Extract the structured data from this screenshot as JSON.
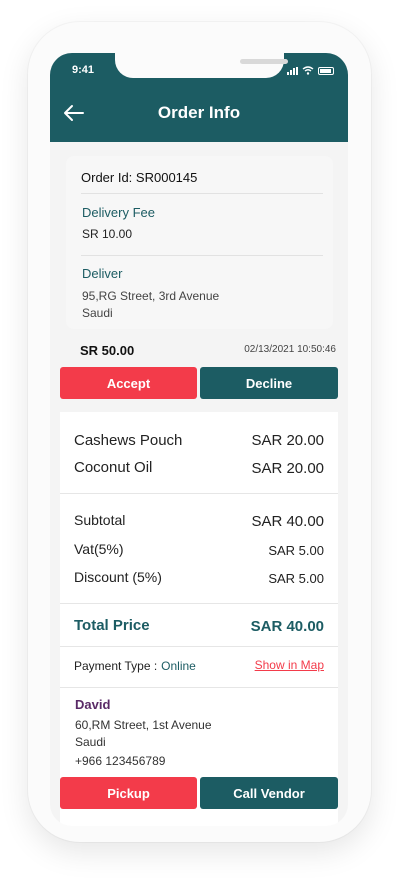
{
  "status_bar": {
    "time": "9:41"
  },
  "header": {
    "title": "Order Info"
  },
  "order": {
    "order_id_label": "Order Id:",
    "order_id": "SR000145",
    "delivery_fee_label": "Delivery Fee",
    "delivery_fee": "SR 10.00",
    "deliver_label": "Deliver",
    "deliver_address_line1": "95,RG Street, 3rd Avenue",
    "deliver_address_line2": "Saudi",
    "price": "SR 50.00",
    "date": "02/13/2021",
    "time": "10:50:46"
  },
  "actions_top": {
    "accept": "Accept",
    "decline": "Decline"
  },
  "items": [
    {
      "name": "Cashews Pouch",
      "price": "SAR 20.00"
    },
    {
      "name": "Coconut Oil",
      "price": "SAR 20.00"
    }
  ],
  "summary": {
    "subtotal_label": "Subtotal",
    "subtotal": "SAR 40.00",
    "vat_label": "Vat(5%)",
    "vat": "SAR 5.00",
    "discount_label": "Discount (5%)",
    "discount": "SAR 5.00",
    "total_label": "Total Price",
    "total": "SAR 40.00"
  },
  "payment": {
    "label": "Payment Type :",
    "value": "Online",
    "map_link": "Show in Map"
  },
  "customer": {
    "name": "David",
    "address_line1": "60,RM Street, 1st Avenue",
    "address_line2": "Saudi",
    "phone": "+966 123456789"
  },
  "actions_bottom": {
    "pickup": "Pickup",
    "call_vendor": "Call Vendor"
  },
  "colors": {
    "primary": "#1c5c63",
    "accent_red": "#f33b4a",
    "name_purple": "#5a2a67"
  },
  "icons": {
    "back": "arrow-left-icon",
    "signal": "signal-icon",
    "wifi": "wifi-icon",
    "battery": "battery-icon"
  }
}
